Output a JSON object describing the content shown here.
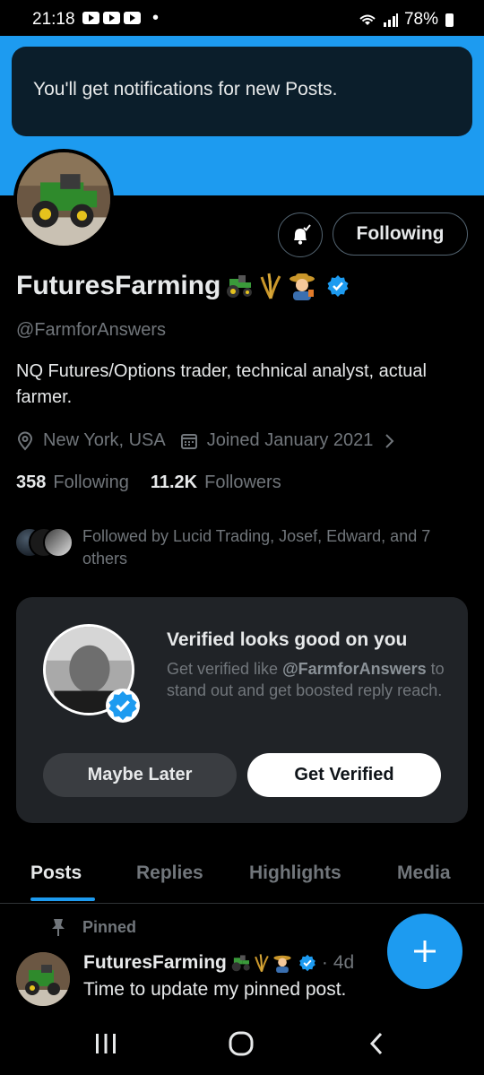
{
  "status_bar": {
    "time": "21:18",
    "dot": "•",
    "battery": "78%"
  },
  "toast": {
    "message": "You'll get notifications for new Posts."
  },
  "profile": {
    "display_name": "FuturesFarming",
    "emojis": [
      "tractor",
      "sheaf-of-rice",
      "farmer"
    ],
    "handle": "@FarmforAnswers",
    "bio": "NQ Futures/Options trader, technical analyst, actual farmer.",
    "location": "New York, USA",
    "joined": "Joined January 2021",
    "following_count": "358",
    "following_label": "Following",
    "followers_count": "11.2K",
    "followers_label": "Followers",
    "followed_by": "Followed by Lucid Trading, Josef, Edward, and 7 others"
  },
  "actions": {
    "following_button": "Following"
  },
  "verify_card": {
    "title": "Verified looks good on you",
    "text_before": "Get verified like ",
    "text_handle": "@FarmforAnswers",
    "text_after": " to stand out and get boosted reply reach.",
    "maybe_later": "Maybe Later",
    "get_verified": "Get Verified"
  },
  "tabs": [
    {
      "label": "Posts",
      "active": true
    },
    {
      "label": "Replies",
      "active": false
    },
    {
      "label": "Highlights",
      "active": false
    },
    {
      "label": "Media",
      "active": false
    }
  ],
  "pinned_post": {
    "pinned_label": "Pinned",
    "author": "FuturesFarming",
    "separator": "·",
    "time": "4d",
    "text": "Time to update my pinned post."
  },
  "colors": {
    "accent": "#1d9bf0",
    "background": "#000000",
    "muted": "#71767b"
  },
  "icons": [
    "bell-check-icon",
    "location-pin-icon",
    "calendar-icon",
    "chevron-right-icon",
    "pin-icon",
    "verified-badge-icon",
    "plus-icon",
    "recent-apps-icon",
    "home-icon",
    "back-icon"
  ]
}
